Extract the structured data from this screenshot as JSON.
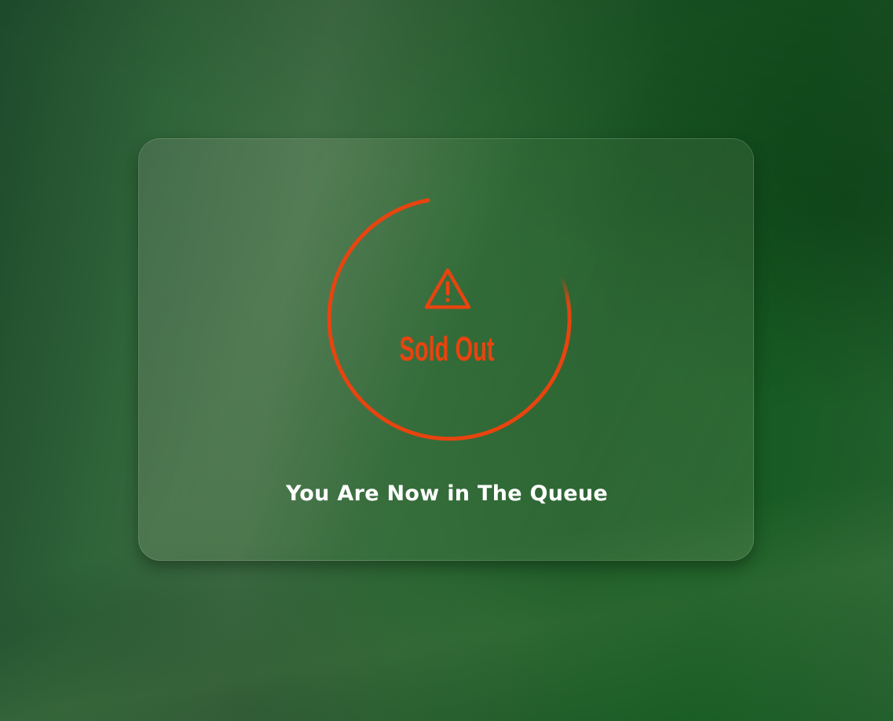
{
  "status": {
    "title": "Sold Out",
    "message": "You Are Now in The Queue",
    "icon": "warning-triangle-icon"
  },
  "colors": {
    "accent": "#e8440f",
    "background": "#2b6633",
    "text": "#ffffff"
  }
}
